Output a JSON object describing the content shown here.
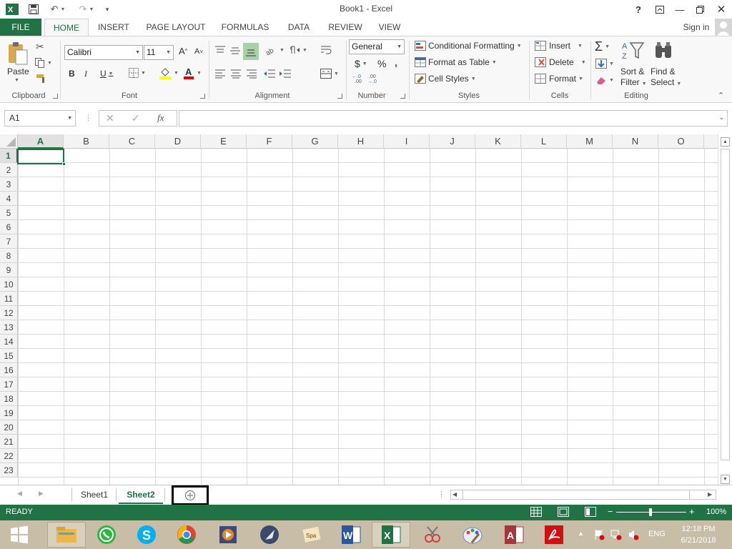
{
  "window": {
    "title": "Book1 - Excel",
    "help": "?",
    "sign_in": "Sign in"
  },
  "tabs": [
    "FILE",
    "HOME",
    "INSERT",
    "PAGE LAYOUT",
    "FORMULAS",
    "DATA",
    "REVIEW",
    "VIEW"
  ],
  "ribbon": {
    "clipboard": {
      "label": "Clipboard",
      "paste": "Paste"
    },
    "font": {
      "label": "Font",
      "name": "Calibri",
      "size": "11",
      "bold": "B",
      "italic": "I",
      "underline": "U",
      "grow": "A",
      "shrink": "A"
    },
    "alignment": {
      "label": "Alignment"
    },
    "number": {
      "label": "Number",
      "format": "General",
      "currency": "$",
      "percent": "%",
      "comma": "‚"
    },
    "styles": {
      "label": "Styles",
      "conditional": "Conditional Formatting",
      "table": "Format as Table",
      "cell_styles": "Cell Styles"
    },
    "cells": {
      "label": "Cells",
      "insert": "Insert",
      "delete": "Delete",
      "format": "Format"
    },
    "editing": {
      "label": "Editing",
      "sort1": "Sort &",
      "sort2": "Filter",
      "find1": "Find &",
      "find2": "Select"
    }
  },
  "formula_bar": {
    "name_box": "A1",
    "fx": "fx",
    "value": ""
  },
  "grid": {
    "columns": [
      "A",
      "B",
      "C",
      "D",
      "E",
      "F",
      "G",
      "H",
      "I",
      "J",
      "K",
      "L",
      "M",
      "N",
      "O"
    ],
    "rows": [
      "1",
      "2",
      "3",
      "4",
      "5",
      "6",
      "7",
      "8",
      "9",
      "10",
      "11",
      "12",
      "13",
      "14",
      "15",
      "16",
      "17",
      "18",
      "19",
      "20",
      "21",
      "22",
      "23"
    ]
  },
  "sheets": [
    "Sheet1",
    "Sheet2"
  ],
  "status": {
    "mode": "READY",
    "zoom": "100%"
  },
  "clock": {
    "time": "12:18 PM",
    "date": "6/21/2018",
    "lang": "ENG"
  },
  "colors": {
    "excel_green": "#217346",
    "taskbar": "#c8bda6"
  }
}
